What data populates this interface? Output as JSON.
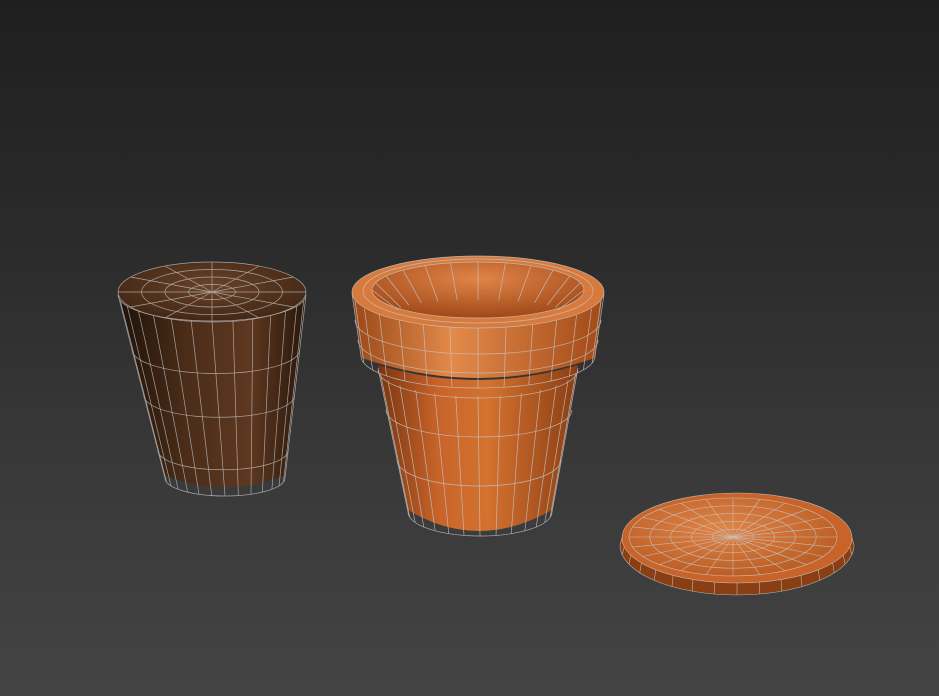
{
  "viewport": {
    "background_top": "#1f1f1f",
    "background_bottom": "#444444",
    "wire_color": "#b8b8b8"
  },
  "objects": [
    {
      "name": "soil-core",
      "color": "#4a2c18",
      "color_dark": "#24140a",
      "color_light": "#6a4228"
    },
    {
      "name": "terracotta-pot",
      "color": "#c8642a",
      "color_dark": "#7a3410",
      "color_light": "#e38a4a"
    },
    {
      "name": "saucer",
      "color": "#c8642a",
      "color_dark": "#7a3410",
      "color_light": "#e08548"
    }
  ]
}
